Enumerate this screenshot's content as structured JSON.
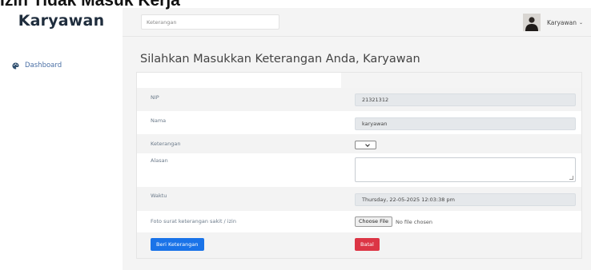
{
  "caption": "Izin Tidak Masuk Kerja",
  "sidebar": {
    "brand": "Karyawan",
    "items": [
      {
        "label": "Dashboard",
        "icon": "palette-icon"
      }
    ]
  },
  "topbar": {
    "search_placeholder": "Keterangan",
    "user_name": "Karyawan",
    "caret": "⌄"
  },
  "main": {
    "title": "Silahkan Masukkan Keterangan Anda, Karyawan"
  },
  "form": {
    "nip_label": "NIP",
    "nip_value": "21321312",
    "nama_label": "Nama",
    "nama_value": "karyawan",
    "keterangan_label": "Keterangan",
    "keterangan_value": "",
    "alasan_label": "Alasan",
    "alasan_value": "",
    "waktu_label": "Waktu",
    "waktu_value": "Thursday, 22-05-2025 12:03:38 pm",
    "foto_label": "Foto surat keterangan sakit / izin",
    "file_button": "Choose File",
    "file_status": "No file chosen",
    "submit_label": "Beri Keterangan",
    "cancel_label": "Batal"
  },
  "colors": {
    "primary": "#1a73e8",
    "danger": "#dc3545",
    "nav_link": "#4a6fa5"
  }
}
